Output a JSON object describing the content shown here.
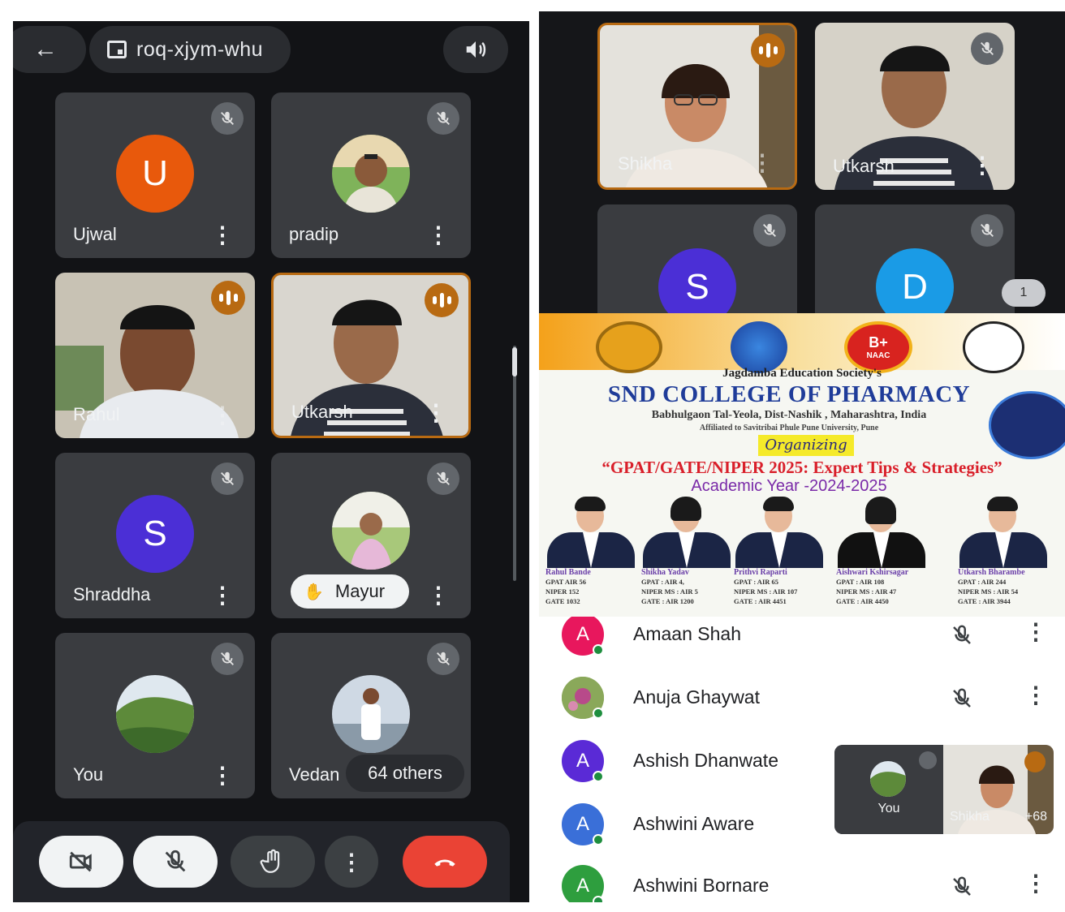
{
  "meeting": {
    "code": "roq-xjym-whu",
    "others_label": "64 others",
    "page_indicator": "1"
  },
  "left_grid": {
    "tiles": [
      {
        "name": "Ujwal",
        "initial": "U",
        "avatar_color": "#e8590c",
        "muted": true
      },
      {
        "name": "pradip",
        "muted": true
      },
      {
        "name": "Rahul",
        "speaking": true
      },
      {
        "name": "Utkarsh",
        "speaking": true
      },
      {
        "name": "Shraddha",
        "initial": "S",
        "avatar_color": "#4b2fd6",
        "muted": true
      },
      {
        "name": "Mayur",
        "hand_raised": true,
        "muted": true
      },
      {
        "name": "You",
        "muted": true
      },
      {
        "name": "Vedan",
        "muted": true
      }
    ]
  },
  "controls": {
    "camera_icon": "camera-off-icon",
    "mic_icon": "mic-off-icon",
    "hand_icon": "raise-hand-icon",
    "more_icon": "more-vert-icon",
    "end_icon": "end-call-icon",
    "end_color": "#ea4335"
  },
  "right_grid": {
    "tiles": [
      {
        "name": "Shikha",
        "speaking": true
      },
      {
        "name": "Utkarsh",
        "muted": true
      },
      {
        "initial": "S",
        "avatar_color": "#4b2fd6",
        "muted": true
      },
      {
        "initial": "D",
        "avatar_color": "#1a9be6",
        "muted": true
      }
    ]
  },
  "poster": {
    "society": "Jagdamba Education Society's",
    "college": "SND COLLEGE OF PHARMACY",
    "address": "Babhulgaon Tal-Yeola, Dist-Nashik , Maharashtra, India",
    "affiliation": "Affiliated to Savitribai Phule Pune University, Pune",
    "organizing": "Organizing",
    "event": "“GPAT/GATE/NIPER 2025: Expert Tips & Strategies”",
    "year": "Academic Year -2024-2025",
    "naac_badge": "B+",
    "naac_label": "NAAC",
    "speakers": [
      {
        "name": "Rahul Bande",
        "lines": [
          "GPAT AIR 56",
          "NIPER 152",
          "GATE 1032"
        ]
      },
      {
        "name": "Shikha Yadav",
        "lines": [
          "GPAT : AIR 4,",
          "NIPER MS : AIR 5",
          "GATE : AIR 1200"
        ]
      },
      {
        "name": "Prithvi Raparti",
        "lines": [
          "GPAT : AIR 65",
          "NIPER MS : AIR 107",
          "GATE : AIR 4451"
        ]
      },
      {
        "name": "Aishwari Kshirsagar",
        "lines": [
          "GPAT : AIR 108",
          "NIPER MS : AIR 47",
          "GATE : AIR 4450"
        ]
      },
      {
        "name": "Utkarsh Bharambe",
        "lines": [
          "GPAT : AIR 244",
          "NIPER MS : AIR 54",
          "GATE : AIR 3944"
        ]
      }
    ]
  },
  "participants": [
    {
      "name": "Amaan Shah",
      "initial": "A",
      "color": "#e8175d"
    },
    {
      "name": "Anuja Ghaywat",
      "initial": "",
      "color": "#7c9a4a"
    },
    {
      "name": "Ashish Dhanwate",
      "initial": "A",
      "color": "#5a2ad6"
    },
    {
      "name": "Ashwini Aware",
      "initial": "A",
      "color": "#3a6fd8"
    },
    {
      "name": "Ashwini Bornare",
      "initial": "A",
      "color": "#2e9e3e"
    }
  ],
  "pip": {
    "self_label": "You",
    "speaker_label": "Shikha",
    "extra_count": "+68"
  }
}
